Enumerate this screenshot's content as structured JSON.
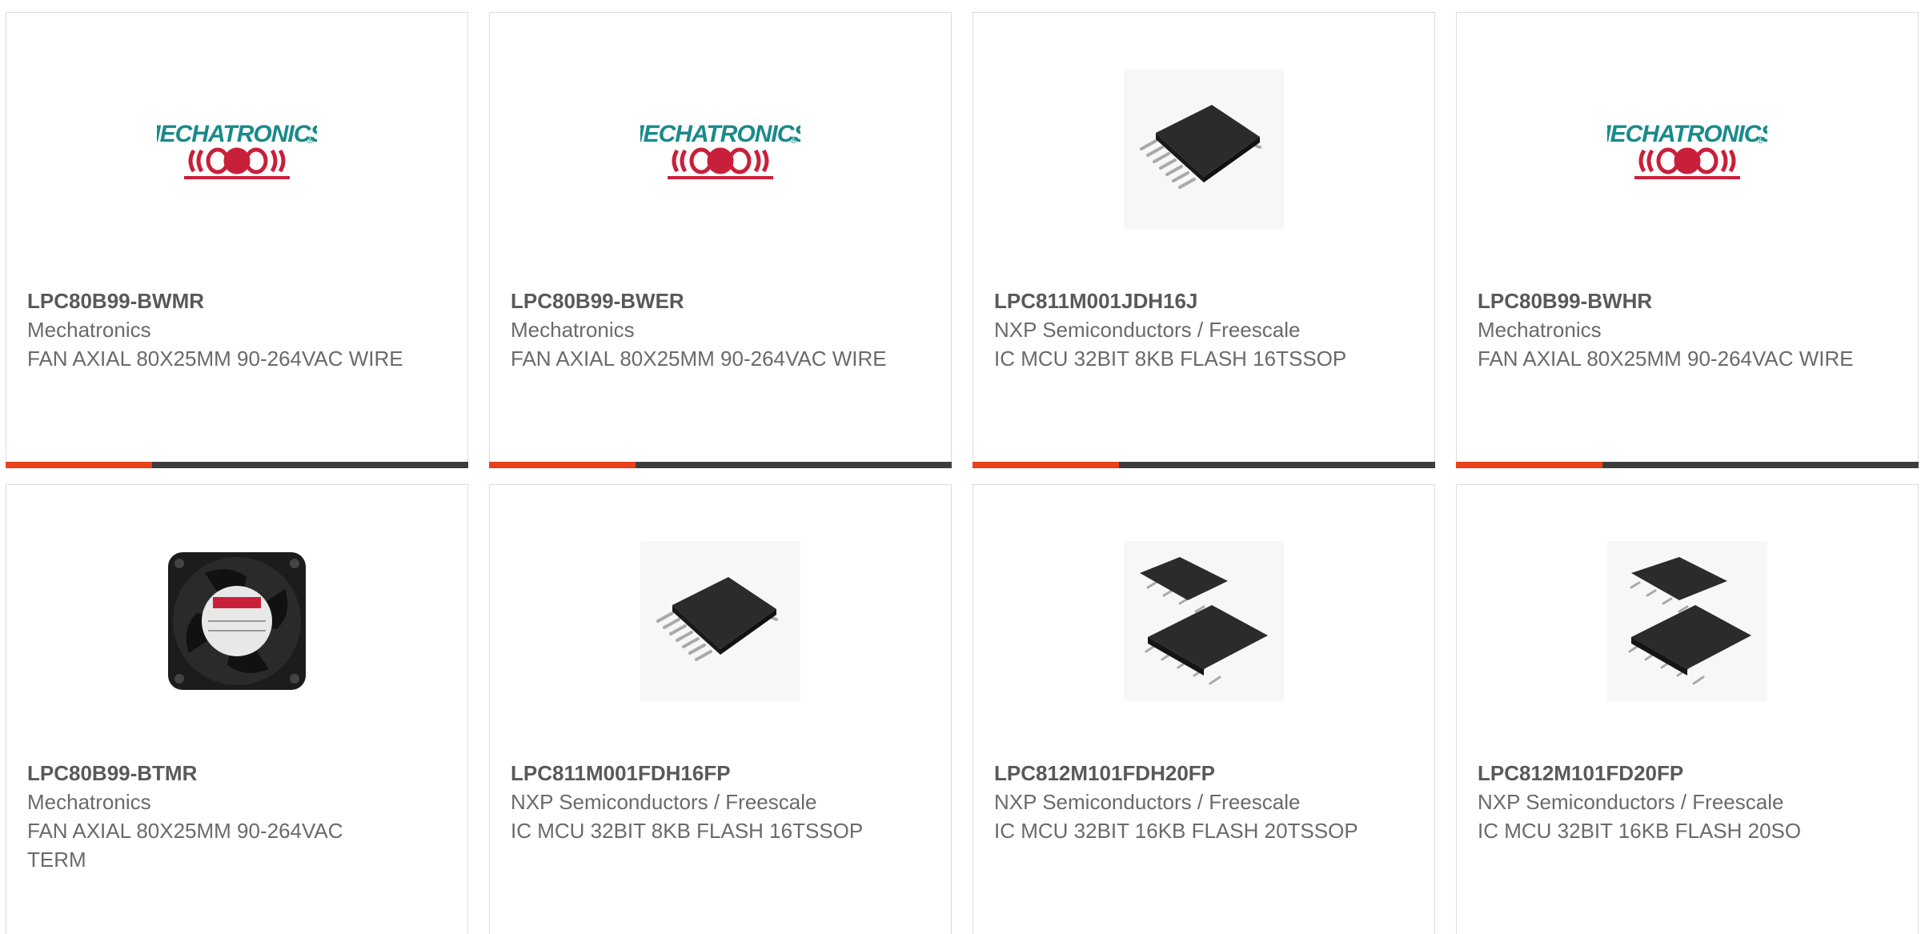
{
  "products": [
    {
      "part": "LPC80B99-BWMR",
      "manufacturer": "Mechatronics",
      "description": "FAN AXIAL 80X25MM 90-264VAC WIRE",
      "image": "mechatronics-logo"
    },
    {
      "part": "LPC80B99-BWER",
      "manufacturer": "Mechatronics",
      "description": "FAN AXIAL 80X25MM 90-264VAC WIRE",
      "image": "mechatronics-logo"
    },
    {
      "part": "LPC811M001JDH16J",
      "manufacturer": "NXP Semiconductors / Freescale",
      "description": "IC MCU 32BIT 8KB FLASH 16TSSOP",
      "image": "tssop-chip"
    },
    {
      "part": "LPC80B99-BWHR",
      "manufacturer": "Mechatronics",
      "description": "FAN AXIAL 80X25MM 90-264VAC WIRE",
      "image": "mechatronics-logo"
    },
    {
      "part": "LPC80B99-BTMR",
      "manufacturer": "Mechatronics",
      "description": "FAN AXIAL 80X25MM 90-264VAC TERM",
      "image": "axial-fan"
    },
    {
      "part": "LPC811M001FDH16FP",
      "manufacturer": "NXP Semiconductors / Freescale",
      "description": "IC MCU 32BIT 8KB FLASH 16TSSOP",
      "image": "tssop-chip"
    },
    {
      "part": "LPC812M101FDH20FP",
      "manufacturer": "NXP Semiconductors / Freescale",
      "description": "IC MCU 32BIT 16KB FLASH 20TSSOP",
      "image": "two-chips"
    },
    {
      "part": "LPC812M101FD20FP",
      "manufacturer": "NXP Semiconductors / Freescale",
      "description": "IC MCU 32BIT 16KB FLASH 20SO",
      "image": "two-chips"
    }
  ],
  "logo": {
    "text": "MECHATRONICS",
    "mark": "®"
  },
  "colors": {
    "accent": "#e8411c",
    "bar": "#3d3d3d",
    "logo_teal": "#1a8a8a",
    "logo_red": "#c8203a"
  }
}
